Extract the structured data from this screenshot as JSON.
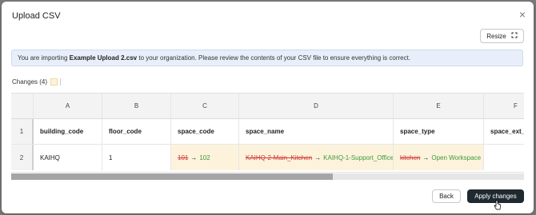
{
  "modal": {
    "title": "Upload CSV",
    "close_icon": "×",
    "resize_label": "Resize",
    "resize_icon": "expand-icon"
  },
  "info": {
    "prefix": "You are importing ",
    "filename": "Example Upload 2.csv",
    "suffix": " to your organization. Please review the contents of your CSV file to ensure everything is correct."
  },
  "changes": {
    "label": "Changes (4)",
    "highlight_color": "#fdf3dc"
  },
  "table": {
    "column_letters": [
      "A",
      "B",
      "C",
      "D",
      "E",
      "F"
    ],
    "row_numbers": [
      "1",
      "2"
    ],
    "column_names": [
      "building_code",
      "floor_code",
      "space_code",
      "space_name",
      "space_type",
      "space_ext_"
    ],
    "row": {
      "building_code": "KAIHQ",
      "floor_code": "1",
      "space_code": {
        "old": "101",
        "arrow": "→",
        "new": "102"
      },
      "space_name": {
        "old": "KAIHQ-2-Main_Kitchen",
        "arrow": "→",
        "new": "KAIHQ-1-Support_Office"
      },
      "space_type": {
        "old": "kitchen",
        "arrow": "→",
        "new": "Open Workspace"
      },
      "space_ext": ""
    }
  },
  "scroll": {
    "position_fraction": 0.63
  },
  "footer": {
    "back_label": "Back",
    "apply_label": "Apply changes"
  },
  "colors": {
    "old_value": "#d23a3a",
    "new_value": "#3d9a3d",
    "primary_button": "#1f2a30",
    "info_background": "#e9effa"
  }
}
